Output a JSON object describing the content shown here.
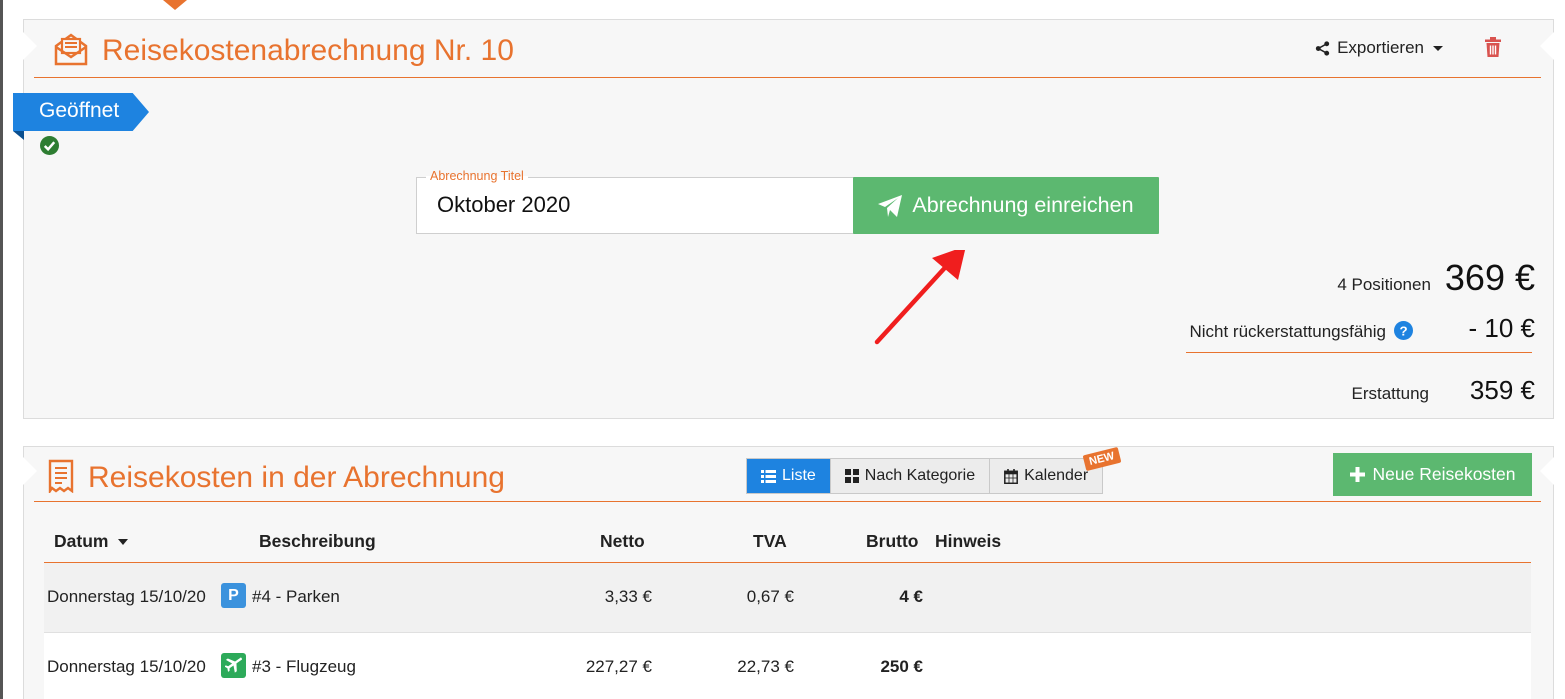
{
  "report": {
    "title": "Reisekostenabrechnung Nr. 10",
    "export_label": "Exportieren",
    "status": "Geöffnet",
    "title_field_label": "Abrechnung Titel",
    "title_field_value": "Oktober 2020",
    "submit_label": "Abrechnung einreichen",
    "summary": {
      "positions_label": "4 Positionen",
      "total": "369 €",
      "non_refundable_label": "Nicht rückerstattungsfähig",
      "non_refundable": "- 10 €",
      "refund_label": "Erstattung",
      "refund": "359 €"
    }
  },
  "expenses": {
    "title": "Reisekosten in der Abrechnung",
    "views": [
      "Liste",
      "Nach Kategorie",
      "Kalender"
    ],
    "active_view": "Liste",
    "new_badge": "NEW",
    "add_label": "Neue Reisekosten",
    "columns": {
      "date": "Datum",
      "description": "Beschreibung",
      "net": "Netto",
      "vat": "TVA",
      "gross": "Brutto",
      "note": "Hinweis"
    },
    "rows": [
      {
        "date": "Donnerstag 15/10/20",
        "icon": "parking-icon",
        "description": "#4 - Parken",
        "net": "3,33 €",
        "vat": "0,67 €",
        "gross": "4 €",
        "note": ""
      },
      {
        "date": "Donnerstag 15/10/20",
        "icon": "airplane-icon",
        "description": "#3 - Flugzeug",
        "net": "227,27 €",
        "vat": "22,73 €",
        "gross": "250 €",
        "note": ""
      }
    ]
  },
  "colors": {
    "accent": "#e8732f",
    "primary": "#1e83e0",
    "success": "#5cb870",
    "danger": "#d9534f"
  }
}
